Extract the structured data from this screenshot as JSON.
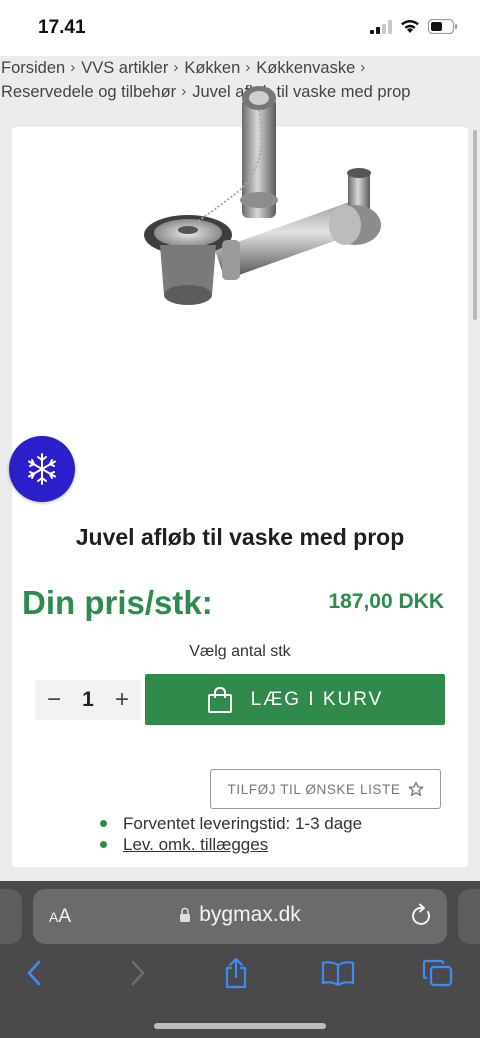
{
  "status": {
    "time": "17.41"
  },
  "breadcrumb": {
    "row1": [
      "Forsiden",
      "VVS artikler",
      "Køkken",
      "Køkkenvaske"
    ],
    "row2": [
      "Reservedele og tilbehør",
      "Juvel afløb til vaske med prop"
    ],
    "separator": "›"
  },
  "product": {
    "image_icon": "sink-drain-image",
    "title": "Juvel afløb til vaske med prop",
    "price_label": "Din pris/stk:",
    "price_value": "187,00 DKK",
    "qty_label": "Vælg antal stk",
    "qty_value": "1",
    "qty_minus": "−",
    "qty_plus": "+",
    "add_to_cart_label": "LÆG I KURV",
    "wishlist_label": "TILFØJ TIL ØNSKE LISTE",
    "delivery_time": "Forventet leveringstid: 1-3 dage",
    "shipping_link": "Lev. omk. tillægges"
  },
  "floating": {
    "icon": "snowflake-icon"
  },
  "browser": {
    "aa_label_small": "A",
    "aa_label_big": "A",
    "url": "bygmax.dk",
    "icons": [
      "back-icon",
      "forward-icon",
      "share-icon",
      "bookmarks-icon",
      "tabs-icon"
    ]
  },
  "colors": {
    "accent_green": "#2e8b4e",
    "button_green": "#2f8a4c",
    "snow_blue": "#2a1fc9",
    "ios_blue": "#3d8cf5"
  }
}
